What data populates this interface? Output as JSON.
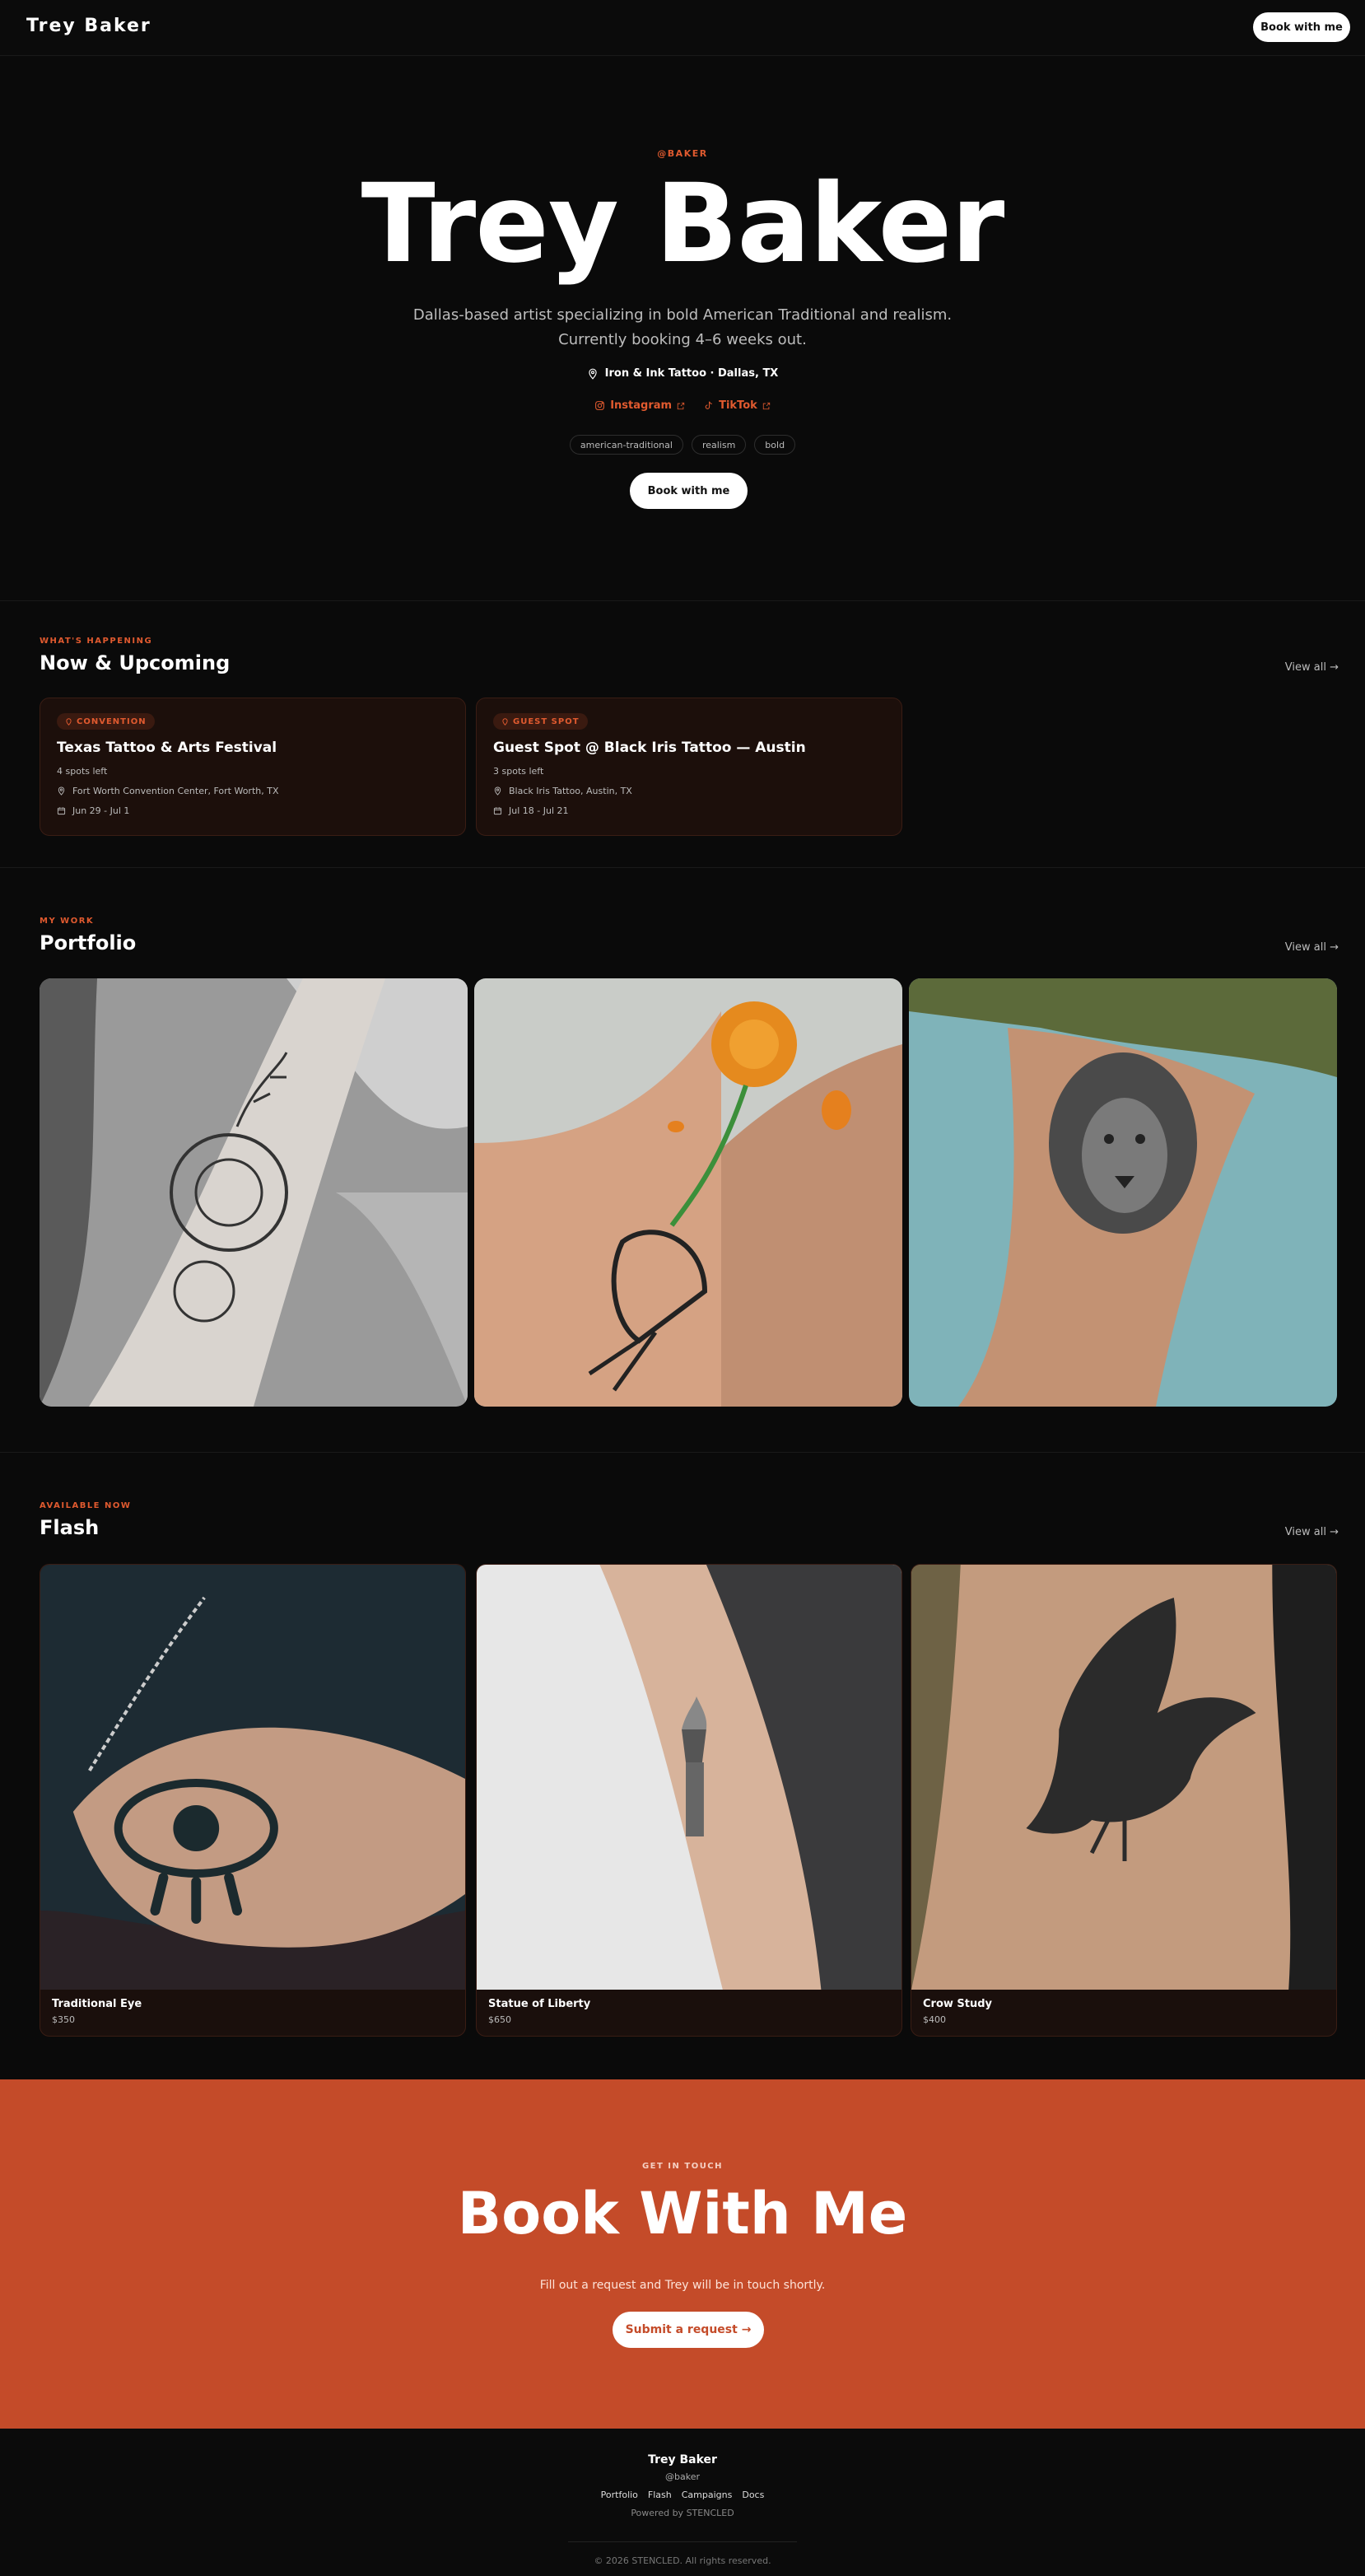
{
  "header": {
    "brand": "Trey Baker",
    "cta": "Book with me"
  },
  "hero": {
    "handle": "@BAKER",
    "title": "Trey Baker",
    "bio": "Dallas-based artist specializing in bold American Traditional and realism. Currently booking 4–6 weeks out.",
    "location": "Iron & Ink Tattoo · Dallas, TX",
    "social": [
      {
        "label": "Instagram",
        "icon": "instagram-icon"
      },
      {
        "label": "TikTok",
        "icon": "tiktok-icon"
      }
    ],
    "tags": [
      "american-traditional",
      "realism",
      "bold"
    ],
    "cta": "Book with me"
  },
  "events": {
    "eyebrow": "WHAT'S HAPPENING",
    "title": "Now & Upcoming",
    "view_all": "View all →",
    "items": [
      {
        "badge": "CONVENTION",
        "title": "Texas Tattoo & Arts Festival",
        "spots": "4 spots left",
        "location": "Fort Worth Convention Center, Fort Worth, TX",
        "dates": "Jun 29 - Jul 1"
      },
      {
        "badge": "GUEST SPOT",
        "title": "Guest Spot @ Black Iris Tattoo — Austin",
        "spots": "3 spots left",
        "location": "Black Iris Tattoo, Austin, TX",
        "dates": "Jul 18 - Jul 21"
      }
    ]
  },
  "portfolio": {
    "eyebrow": "MY WORK",
    "title": "Portfolio",
    "view_all": "View all →"
  },
  "flash": {
    "eyebrow": "AVAILABLE NOW",
    "title": "Flash",
    "view_all": "View all →",
    "items": [
      {
        "name": "Traditional Eye",
        "price": "$350"
      },
      {
        "name": "Statue of Liberty",
        "price": "$650"
      },
      {
        "name": "Crow Study",
        "price": "$400"
      }
    ]
  },
  "booking": {
    "eyebrow": "GET IN TOUCH",
    "title": "Book With Me",
    "subtitle": "Fill out a request and Trey will be in touch shortly.",
    "cta": "Submit a request →"
  },
  "footer": {
    "name": "Trey Baker",
    "handle": "@baker",
    "links": [
      "Portfolio",
      "Flash",
      "Campaigns",
      "Docs"
    ],
    "powered": "Powered by STENCLED",
    "copyright": "© 2026 STENCLED. All rights reserved."
  },
  "colors": {
    "accent": "#e05a2f",
    "booking_bg": "#c44b29",
    "background": "#0a0a0a",
    "card_bg": "#1c0f0b"
  }
}
